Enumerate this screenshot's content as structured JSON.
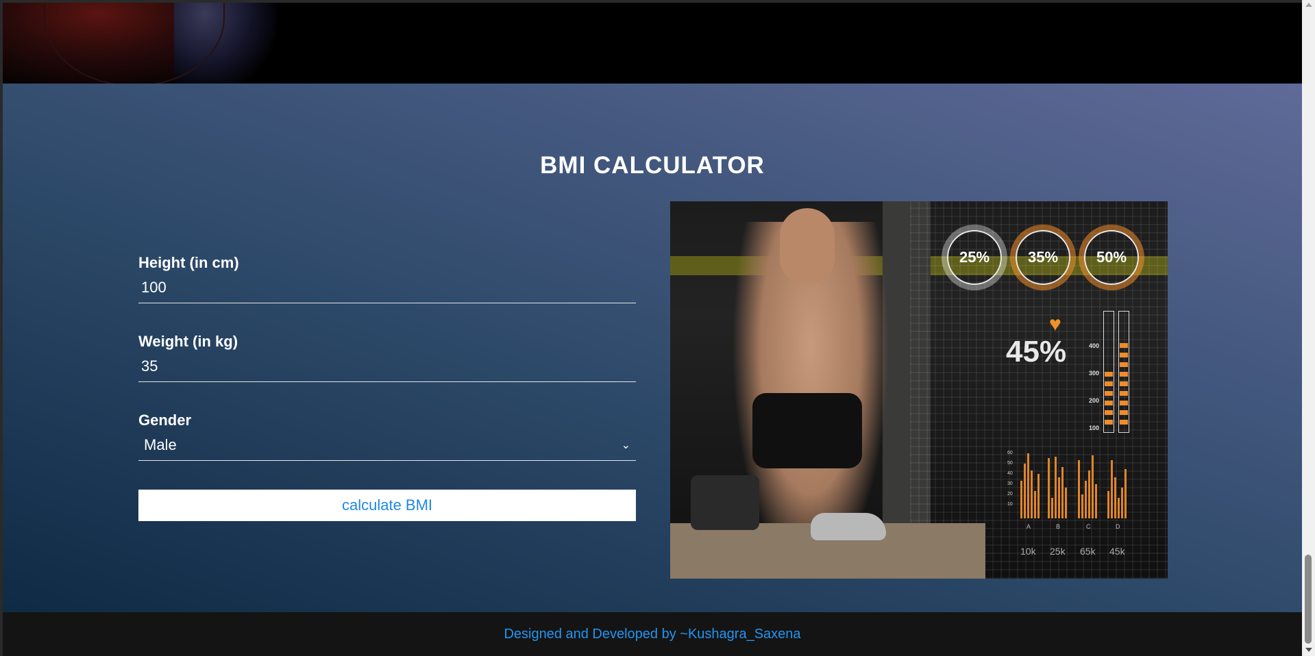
{
  "header": {
    "hero_image": "hero-athlete-image"
  },
  "calculator": {
    "title": "BMI CALCULATOR",
    "height_label": "Height (in cm)",
    "height_value": "100",
    "weight_label": "Weight (in kg)",
    "weight_value": "35",
    "gender_label": "Gender",
    "gender_value": "Male",
    "submit_label": "calculate BMI"
  },
  "illustration": {
    "rings": [
      "25%",
      "35%",
      "50%"
    ],
    "big_percent": "45%",
    "scale": [
      "400",
      "300",
      "200",
      "100"
    ],
    "bar_groups": [
      "A",
      "B",
      "C",
      "D"
    ],
    "bar_values": [
      "10k",
      "25k",
      "65k",
      "45k"
    ],
    "y_ticks": [
      "60",
      "50",
      "40",
      "30",
      "20",
      "10"
    ]
  },
  "footer": {
    "credit": "Designed and Developed by ~Kushagra_Saxena"
  },
  "colors": {
    "accent": "#1e88e5",
    "footer_text": "#2196f3",
    "chart_orange": "#f08c2a"
  }
}
